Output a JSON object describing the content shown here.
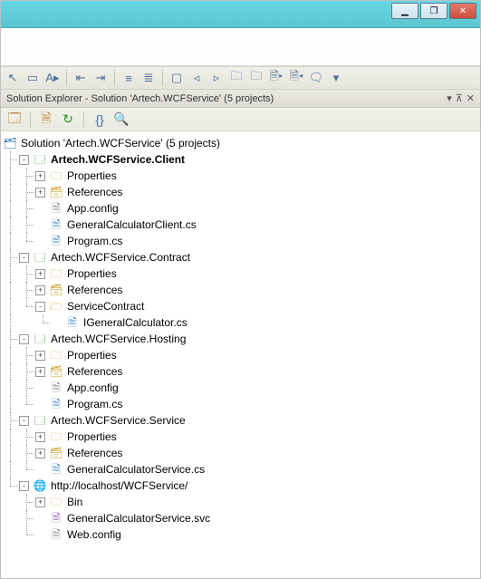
{
  "domain": "Computer-Use",
  "panel_title": "Solution Explorer - Solution 'Artech.WCFService' (5 projects)",
  "solution_label": "Solution 'Artech.WCFService' (5 projects)",
  "win": {
    "minimize": "▁",
    "maximize": "❐",
    "close": "✕"
  },
  "header_icons": {
    "dropdown": "▾",
    "pin": "⊼",
    "close": "✕"
  },
  "tree": [
    {
      "name": "Artech.WCFService.Client",
      "selected": true,
      "children": [
        {
          "name": "Properties",
          "icon": "folder",
          "expandable": true
        },
        {
          "name": "References",
          "icon": "ref",
          "expandable": true
        },
        {
          "name": "App.config",
          "icon": "config"
        },
        {
          "name": "GeneralCalculatorClient.cs",
          "icon": "cs"
        },
        {
          "name": "Program.cs",
          "icon": "cs"
        }
      ]
    },
    {
      "name": "Artech.WCFService.Contract",
      "children": [
        {
          "name": "Properties",
          "icon": "folder",
          "expandable": true
        },
        {
          "name": "References",
          "icon": "ref",
          "expandable": true
        },
        {
          "name": "ServiceContract",
          "icon": "folder-open",
          "children": [
            {
              "name": "IGeneralCalculator.cs",
              "icon": "cs"
            }
          ]
        }
      ]
    },
    {
      "name": "Artech.WCFService.Hosting",
      "children": [
        {
          "name": "Properties",
          "icon": "folder",
          "expandable": true
        },
        {
          "name": "References",
          "icon": "ref",
          "expandable": true
        },
        {
          "name": "App.config",
          "icon": "config"
        },
        {
          "name": "Program.cs",
          "icon": "cs"
        }
      ]
    },
    {
      "name": "Artech.WCFService.Service",
      "children": [
        {
          "name": "Properties",
          "icon": "folder",
          "expandable": true
        },
        {
          "name": "References",
          "icon": "ref",
          "expandable": true
        },
        {
          "name": "GeneralCalculatorService.cs",
          "icon": "cs"
        }
      ]
    },
    {
      "name": "http://localhost/WCFService/",
      "icon": "globe",
      "children": [
        {
          "name": "Bin",
          "icon": "folder",
          "expandable": true
        },
        {
          "name": "GeneralCalculatorService.svc",
          "icon": "svc"
        },
        {
          "name": "Web.config",
          "icon": "config"
        }
      ]
    }
  ]
}
